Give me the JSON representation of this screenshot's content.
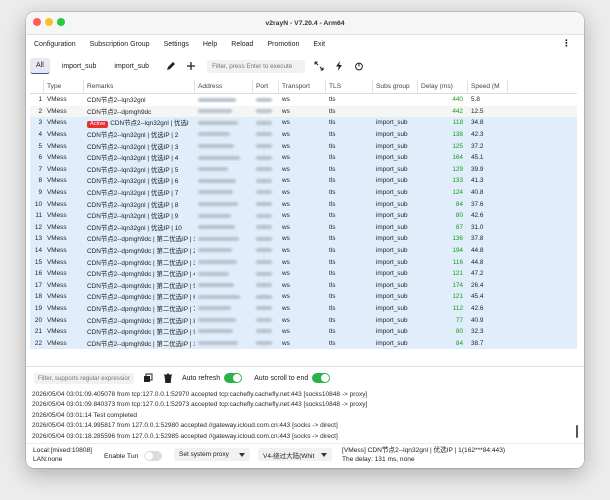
{
  "window": {
    "title": "v2rayN - V7.20.4 - Arm64"
  },
  "menu": [
    "Configuration",
    "Subscription Group",
    "Settings",
    "Help",
    "Reload",
    "Promotion",
    "Exit"
  ],
  "tabs": [
    "All",
    "import_sub",
    "import_sub"
  ],
  "toolbar": {
    "filter_placeholder": "Filter, press Enter to execute"
  },
  "columns": [
    "Type",
    "Remarks",
    "Address",
    "Port",
    "Transport",
    "TLS",
    "Subs group",
    "Delay (ms)",
    "Speed (M"
  ],
  "rows": [
    {
      "idx": "1",
      "type": "VMess",
      "remarks": "CDN节点2--lqn32gnl",
      "transport": "ws",
      "tls": "tls",
      "subs": "",
      "delay": "440",
      "speed": "5.8",
      "active": false
    },
    {
      "idx": "2",
      "type": "VMess",
      "remarks": "CDN节点2--dpmgh9dc",
      "transport": "ws",
      "tls": "tls",
      "subs": "",
      "delay": "442",
      "speed": "12.5",
      "active": false
    },
    {
      "idx": "3",
      "type": "VMess",
      "remarks": "CDN节点2--lqn32gnl | 优选I",
      "transport": "ws",
      "tls": "tls",
      "subs": "import_sub",
      "delay": "118",
      "speed": "34.8",
      "active": true
    },
    {
      "idx": "4",
      "type": "VMess",
      "remarks": "CDN节点2--lqn32gnl | 优选IP | 2",
      "transport": "ws",
      "tls": "tls",
      "subs": "import_sub",
      "delay": "138",
      "speed": "42.3",
      "active": false
    },
    {
      "idx": "5",
      "type": "VMess",
      "remarks": "CDN节点2--lqn32gnl | 优选IP | 3",
      "transport": "ws",
      "tls": "tls",
      "subs": "import_sub",
      "delay": "125",
      "speed": "37.2",
      "active": false
    },
    {
      "idx": "6",
      "type": "VMess",
      "remarks": "CDN节点2--lqn32gnl | 优选IP | 4",
      "transport": "ws",
      "tls": "tls",
      "subs": "import_sub",
      "delay": "164",
      "speed": "45.1",
      "active": false
    },
    {
      "idx": "7",
      "type": "VMess",
      "remarks": "CDN节点2--lqn32gnl | 优选IP | 5",
      "transport": "ws",
      "tls": "tls",
      "subs": "import_sub",
      "delay": "129",
      "speed": "39.9",
      "active": false
    },
    {
      "idx": "8",
      "type": "VMess",
      "remarks": "CDN节点2--lqn32gnl | 优选IP | 6",
      "transport": "ws",
      "tls": "tls",
      "subs": "import_sub",
      "delay": "133",
      "speed": "41.3",
      "active": false
    },
    {
      "idx": "9",
      "type": "VMess",
      "remarks": "CDN节点2--lqn32gnl | 优选IP | 7",
      "transport": "ws",
      "tls": "tls",
      "subs": "import_sub",
      "delay": "124",
      "speed": "40.8",
      "active": false
    },
    {
      "idx": "10",
      "type": "VMess",
      "remarks": "CDN节点2--lqn32gnl | 优选IP | 8",
      "transport": "ws",
      "tls": "tls",
      "subs": "import_sub",
      "delay": "84",
      "speed": "37.6",
      "active": false
    },
    {
      "idx": "11",
      "type": "VMess",
      "remarks": "CDN节点2--lqn32gnl | 优选IP | 9",
      "transport": "ws",
      "tls": "tls",
      "subs": "import_sub",
      "delay": "80",
      "speed": "42.6",
      "active": false
    },
    {
      "idx": "12",
      "type": "VMess",
      "remarks": "CDN节点2--lqn32gnl | 优选IP | 10",
      "transport": "ws",
      "tls": "tls",
      "subs": "import_sub",
      "delay": "87",
      "speed": "31.0",
      "active": false
    },
    {
      "idx": "13",
      "type": "VMess",
      "remarks": "CDN节点2--dpmgh9dc | 第二优选IP | 1",
      "transport": "ws",
      "tls": "tls",
      "subs": "import_sub",
      "delay": "136",
      "speed": "37.8",
      "active": false
    },
    {
      "idx": "14",
      "type": "VMess",
      "remarks": "CDN节点2--dpmgh9dc | 第二优选IP | 2",
      "transport": "ws",
      "tls": "tls",
      "subs": "import_sub",
      "delay": "194",
      "speed": "44.8",
      "active": false
    },
    {
      "idx": "15",
      "type": "VMess",
      "remarks": "CDN节点2--dpmgh9dc | 第二优选IP | 3",
      "transport": "ws",
      "tls": "tls",
      "subs": "import_sub",
      "delay": "116",
      "speed": "44.8",
      "active": false
    },
    {
      "idx": "16",
      "type": "VMess",
      "remarks": "CDN节点2--dpmgh9dc | 第二优选IP | 4",
      "transport": "ws",
      "tls": "tls",
      "subs": "import_sub",
      "delay": "121",
      "speed": "47.2",
      "active": false
    },
    {
      "idx": "17",
      "type": "VMess",
      "remarks": "CDN节点2--dpmgh9dc | 第二优选IP | 5",
      "transport": "ws",
      "tls": "tls",
      "subs": "import_sub",
      "delay": "174",
      "speed": "26.4",
      "active": false
    },
    {
      "idx": "18",
      "type": "VMess",
      "remarks": "CDN节点2--dpmgh9dc | 第二优选IP | 6",
      "transport": "ws",
      "tls": "tls",
      "subs": "import_sub",
      "delay": "121",
      "speed": "45.4",
      "active": false
    },
    {
      "idx": "19",
      "type": "VMess",
      "remarks": "CDN节点2--dpmgh9dc | 第二优选IP | 7",
      "transport": "ws",
      "tls": "tls",
      "subs": "import_sub",
      "delay": "112",
      "speed": "42.6",
      "active": false
    },
    {
      "idx": "20",
      "type": "VMess",
      "remarks": "CDN节点2--dpmgh9dc | 第二优选IP | 8",
      "transport": "ws",
      "tls": "tls",
      "subs": "import_sub",
      "delay": "77",
      "speed": "40.9",
      "active": false
    },
    {
      "idx": "21",
      "type": "VMess",
      "remarks": "CDN节点2--dpmgh9dc | 第二优选IP | 9",
      "transport": "ws",
      "tls": "tls",
      "subs": "import_sub",
      "delay": "80",
      "speed": "32.3",
      "active": false
    },
    {
      "idx": "22",
      "type": "VMess",
      "remarks": "CDN节点2--dpmgh9dc | 第二优选IP | 10",
      "transport": "ws",
      "tls": "tls",
      "subs": "import_sub",
      "delay": "84",
      "speed": "38.7",
      "active": false
    }
  ],
  "active_badge": "Active",
  "logbar": {
    "filter_placeholder": "Filter, supports regular expressions",
    "auto_refresh_label": "Auto refresh",
    "auto_refresh_on": true,
    "auto_scroll_label": "Auto scroll to end",
    "auto_scroll_on": true
  },
  "logs": [
    "2026/05/04 03:01:09.405078 from tcp:127.0.0.1:52970 accepted tcp:cachefly.cachefly.net:443 [socks10848 -> proxy]",
    "2026/05/04 03:01:09.840373 from tcp:127.0.0.1:52973 accepted tcp:cachefly.cachefly.net:443 [socks10848 -> proxy]",
    "2026/05/04 03:01:14 Test completed",
    "2026/05/04 03:01:14.995817 from 127.0.0.1:52980 accepted //gateway.icloud.com.cn:443 [socks -> direct]",
    "2026/05/04 03:01:18.285596 from 127.0.0.1:52985 accepted //gateway.icloud.com.cn:443 [socks -> direct]"
  ],
  "status": {
    "local": "Local:[mixed:10808]",
    "lan": "LAN:none",
    "tun_label": "Enable Tun",
    "tun_on": false,
    "sysproxy": "Set system proxy",
    "routing": "V4-绕过大陆(Whit",
    "server_info": "[VMess] CDN节点2--lqn32gnl | 优选IP | 1(162***84:443)",
    "delay_info": "The delay: 131 ms, none"
  }
}
